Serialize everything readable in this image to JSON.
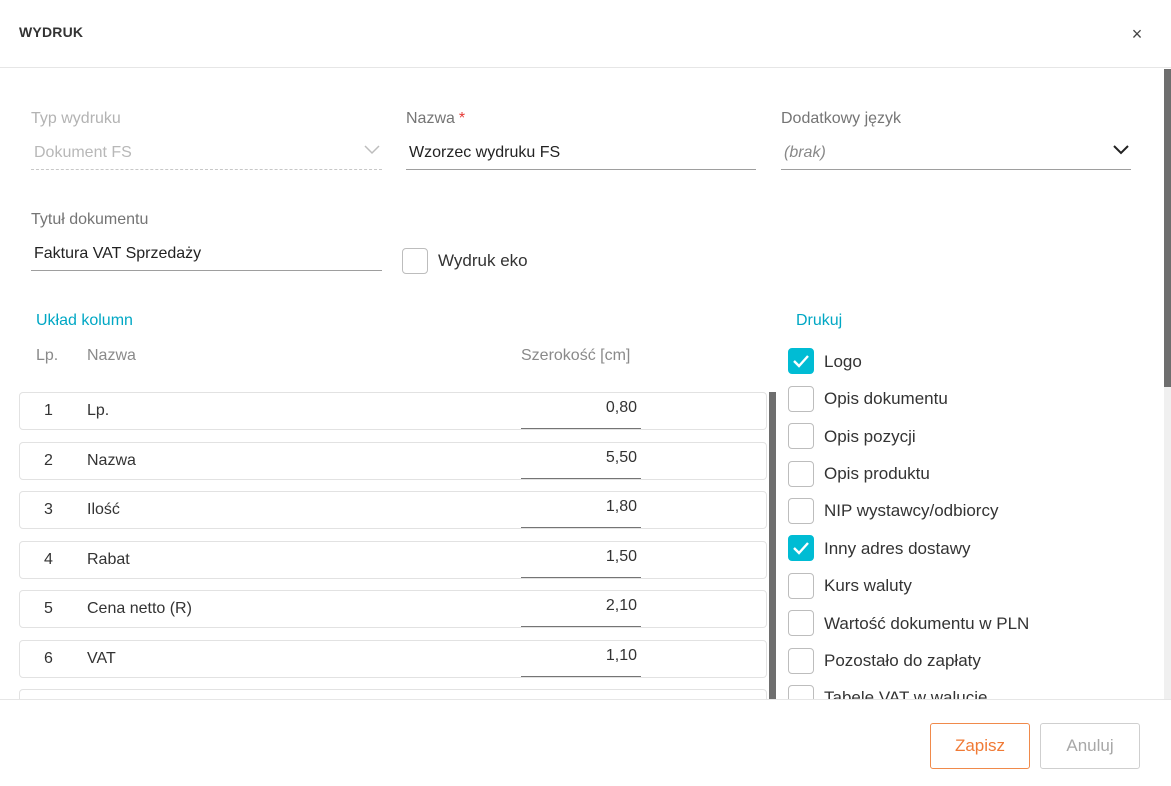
{
  "dialog": {
    "title": "WYDRUK",
    "close_symbol": "×"
  },
  "form": {
    "print_type": {
      "label": "Typ wydruku",
      "value": "Dokument FS"
    },
    "name": {
      "label": "Nazwa",
      "required_mark": "*",
      "value": "Wzorzec wydruku FS"
    },
    "extra_language": {
      "label": "Dodatkowy język",
      "value": "(brak)"
    },
    "doc_title": {
      "label": "Tytuł dokumentu",
      "value": "Faktura VAT Sprzedaży"
    },
    "eco_print": {
      "label": "Wydruk eko",
      "checked": false
    }
  },
  "columns": {
    "section_title": "Układ kolumn",
    "headers": {
      "lp": "Lp.",
      "name": "Nazwa",
      "width": "Szerokość [cm]"
    },
    "rows": [
      {
        "lp": "1",
        "name": "Lp.",
        "width": "0,80"
      },
      {
        "lp": "2",
        "name": "Nazwa",
        "width": "5,50"
      },
      {
        "lp": "3",
        "name": "Ilość",
        "width": "1,80"
      },
      {
        "lp": "4",
        "name": "Rabat",
        "width": "1,50"
      },
      {
        "lp": "5",
        "name": "Cena netto (R)",
        "width": "2,10"
      },
      {
        "lp": "6",
        "name": "VAT",
        "width": "1,10"
      },
      {
        "lp": "",
        "name": "",
        "width": ""
      }
    ]
  },
  "print_options": {
    "section_title": "Drukuj",
    "items": [
      {
        "label": "Logo",
        "checked": true
      },
      {
        "label": "Opis dokumentu",
        "checked": false
      },
      {
        "label": "Opis pozycji",
        "checked": false
      },
      {
        "label": "Opis produktu",
        "checked": false
      },
      {
        "label": "NIP wystawcy/odbiorcy",
        "checked": false
      },
      {
        "label": "Inny adres dostawy",
        "checked": true
      },
      {
        "label": "Kurs waluty",
        "checked": false
      },
      {
        "label": "Wartość dokumentu w PLN",
        "checked": false
      },
      {
        "label": "Pozostało do zapłaty",
        "checked": false
      },
      {
        "label": "Tabele VAT w walucie",
        "checked": false
      }
    ]
  },
  "footer": {
    "save_label": "Zapisz",
    "cancel_label": "Anuluj"
  },
  "colors": {
    "accent": "#00bcd4",
    "section_title": "#00a7c4",
    "save": "#f07a35",
    "required": "#e53935"
  }
}
